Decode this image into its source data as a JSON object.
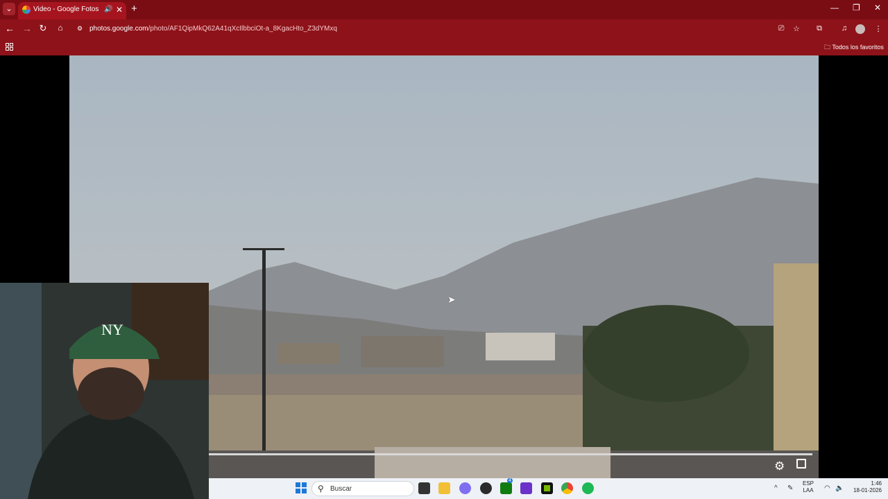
{
  "browser": {
    "tab": {
      "title": "Video - Google Fotos",
      "favicon": "google-photos-icon",
      "sound_icon": "speaker-icon",
      "close_icon": "close-icon"
    },
    "new_tab_label": "+",
    "window_controls": [
      "minimize",
      "restore",
      "close"
    ],
    "url": {
      "domain": "photos.google.com",
      "path": "/photo/AF1QipMkQ62A41qXcIlbbciOt-a_8KgacHto_Z3dYMxq"
    },
    "bookmarks_label": "Todos los favoritos"
  },
  "player": {
    "settings_icon": "gear-icon",
    "fullscreen_icon": "fullscreen-icon",
    "progress": 1.0
  },
  "taskbar": {
    "search_placeholder": "Buscar",
    "language_top": "ESP",
    "language_bottom": "LAA",
    "time": "1:46",
    "date": "18-01-2026",
    "badge_count": "4"
  },
  "colors": {
    "chrome_dark": "#7a0d14",
    "chrome": "#8e1219",
    "taskbar": "#eef1f6"
  }
}
